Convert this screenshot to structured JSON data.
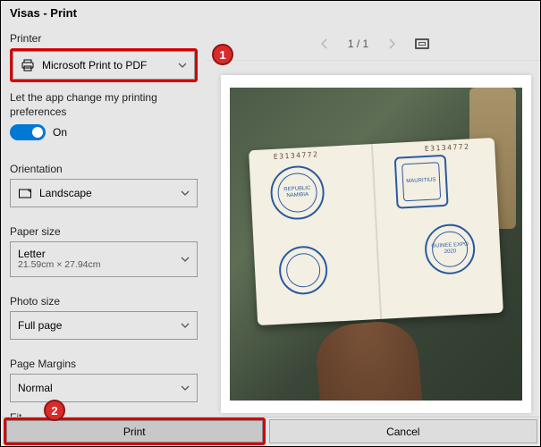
{
  "window": {
    "title": "Visas - Print"
  },
  "left": {
    "printer_label": "Printer",
    "printer_value": "Microsoft Print to PDF",
    "pref_text": "Let the app change my printing preferences",
    "toggle_state": "On",
    "orientation_label": "Orientation",
    "orientation_value": "Landscape",
    "paper_label": "Paper size",
    "paper_value": "Letter",
    "paper_sub": "21.59cm × 27.94cm",
    "photo_label": "Photo size",
    "photo_value": "Full page",
    "margins_label": "Page Margins",
    "margins_value": "Normal",
    "fit_label": "Fit"
  },
  "right": {
    "page_indicator": "1 / 1",
    "stamps": {
      "s1": "REPUBLIC NAMIBIA",
      "s3": "MAURITIUS",
      "s4": "GUINEE EXPO 2020"
    },
    "passnum_left": "E3134772",
    "passnum_right": "E3134772"
  },
  "buttons": {
    "print": "Print",
    "cancel": "Cancel"
  },
  "callouts": {
    "c1": "1",
    "c2": "2"
  }
}
